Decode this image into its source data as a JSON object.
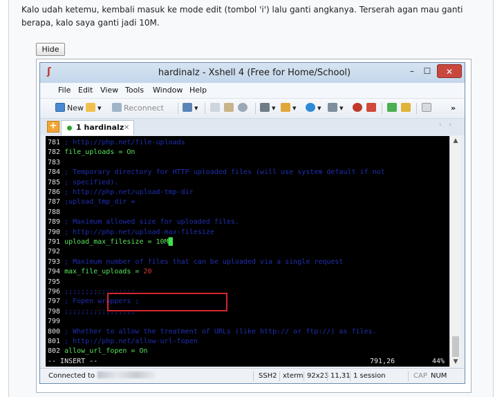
{
  "post": {
    "text": "Kalo udah ketemu, kembali masuk ke mode edit (tombol 'i') lalu ganti angkanya. Terserah agan mau ganti berapa, kalo saya ganti jadi 10M.",
    "hide_button": "Hide"
  },
  "window": {
    "title": "hardinalz - Xshell 4 (Free for Home/School)",
    "min_glyph": "–",
    "max_glyph": "☐",
    "close_glyph": "✕"
  },
  "menu": [
    "File",
    "Edit",
    "View",
    "Tools",
    "Window",
    "Help"
  ],
  "toolbar": {
    "new_label": "New",
    "reconnect_label": "Reconnect"
  },
  "tabs": [
    {
      "label": "1 hardinalz",
      "close": "×"
    }
  ],
  "terminal": {
    "lines": [
      {
        "ln": "781",
        "text": " ; http://php.net/file-uploads",
        "kind": "comment"
      },
      {
        "ln": "782",
        "text": " file_uploads = On",
        "kind": "directive"
      },
      {
        "ln": "783",
        "text": "",
        "kind": "blank"
      },
      {
        "ln": "784",
        "text": " ; Temporary directory for HTTP uploaded files (will use system default if not",
        "kind": "comment"
      },
      {
        "ln": "785",
        "text": " ; specified).",
        "kind": "comment"
      },
      {
        "ln": "786",
        "text": " ; http://php.net/upload-tmp-dir",
        "kind": "comment"
      },
      {
        "ln": "787",
        "text": " ;upload_tmp_dir =",
        "kind": "comment"
      },
      {
        "ln": "788",
        "text": "",
        "kind": "blank"
      },
      {
        "ln": "789",
        "text": " ; Maximum allowed size for uploaded files.",
        "kind": "comment"
      },
      {
        "ln": "790",
        "text": " ; http://php.net/upload-max-filesize",
        "kind": "comment"
      },
      {
        "ln": "791",
        "text": " upload_max_filesize = 10M",
        "kind": "edited"
      },
      {
        "ln": "792",
        "text": "",
        "kind": "blank"
      },
      {
        "ln": "793",
        "text": " ; Maximum number of files that can be uploaded via a single request",
        "kind": "comment"
      },
      {
        "ln": "794",
        "text": " max_file_uploads = 20",
        "kind": "number"
      },
      {
        "ln": "795",
        "text": "",
        "kind": "blank"
      },
      {
        "ln": "796",
        "text": " ;;;;;;;;;;;;;;;;;",
        "kind": "comment"
      },
      {
        "ln": "797",
        "text": " ; Fopen wrappers ;",
        "kind": "comment"
      },
      {
        "ln": "798",
        "text": " ;;;;;;;;;;;;;;;;;",
        "kind": "comment"
      },
      {
        "ln": "799",
        "text": "",
        "kind": "blank"
      },
      {
        "ln": "800",
        "text": " ; Whether to allow the treatment of URLs (like http:// or ftp://) as files.",
        "kind": "comment"
      },
      {
        "ln": "801",
        "text": " ; http://php.net/allow-url-fopen",
        "kind": "comment"
      },
      {
        "ln": "802",
        "text": " allow_url_fopen = On",
        "kind": "directive"
      }
    ],
    "mode": "-- INSERT --",
    "position": "791,26",
    "percent": "44%"
  },
  "statusbar": {
    "connected": "Connected to",
    "protocol": "SSH2",
    "term": "xterm",
    "size": "92x23",
    "cursor": "11,31",
    "sessions": "1 session",
    "cap": "CAP",
    "num": "NUM"
  },
  "colors": {
    "comment": "#1f2fb0",
    "directive": "#59e35c",
    "number": "#d93a3a",
    "highlight_box": "#d5262f",
    "close_button": "#c9483d"
  }
}
